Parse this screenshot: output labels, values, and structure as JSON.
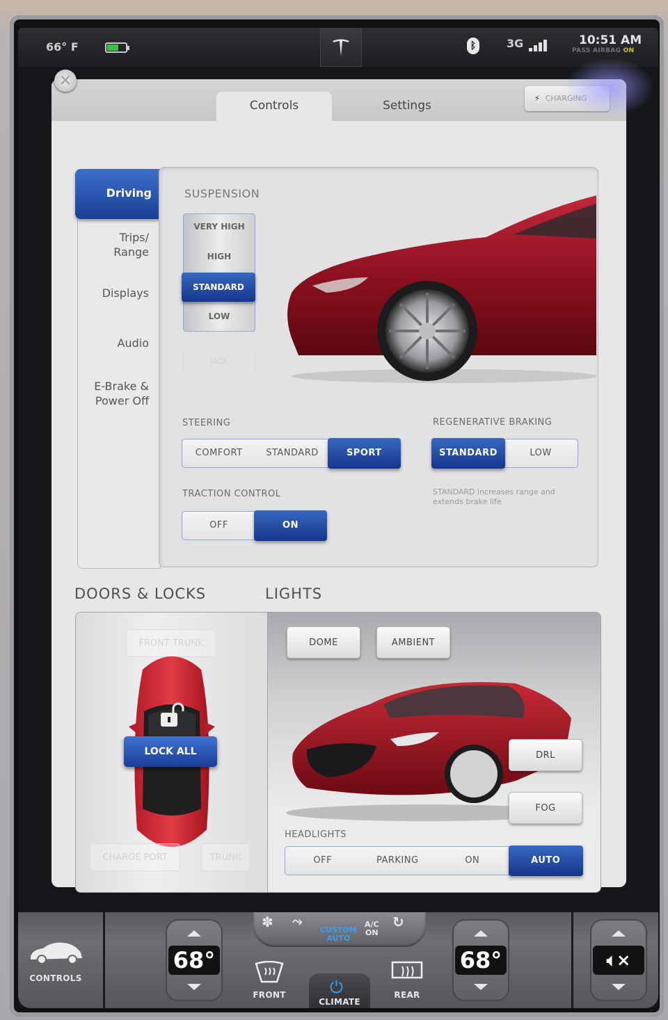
{
  "status_bar": {
    "outside_temp": "66° F",
    "battery_level_pct": 60,
    "battery_color": "#3fbd47",
    "logo_icon": "tesla-logo-icon",
    "bluetooth_icon": "bluetooth-icon",
    "network": "3G",
    "signal_bars": 4,
    "time": "10:51 AM",
    "airbag_label": "PASS AIRBAG",
    "airbag_state": "ON"
  },
  "panel": {
    "close_icon": "close-icon",
    "tabs": [
      {
        "label": "Controls",
        "active": true
      },
      {
        "label": "Settings",
        "active": false
      }
    ],
    "charging_button": "CHARGING"
  },
  "sidenav": {
    "items": [
      {
        "label": "Driving",
        "active": true
      },
      {
        "label": "Trips/ Range",
        "active": false
      },
      {
        "label": "Displays",
        "active": false
      },
      {
        "label": "Audio",
        "active": false
      },
      {
        "label": "E-Brake & Power Off",
        "active": false
      }
    ]
  },
  "driving": {
    "suspension": {
      "label": "SUSPENSION",
      "options": [
        "VERY HIGH",
        "HIGH",
        "STANDARD",
        "LOW"
      ],
      "selected": "STANDARD",
      "jack_label": "JACK"
    },
    "steering": {
      "label": "STEERING",
      "options": [
        "COMFORT",
        "STANDARD",
        "SPORT"
      ],
      "selected": "SPORT"
    },
    "regen_braking": {
      "label": "REGENERATIVE BRAKING",
      "options": [
        "STANDARD",
        "LOW"
      ],
      "selected": "STANDARD",
      "hint": "STANDARD increases range and extends brake life"
    },
    "traction_control": {
      "label": "TRACTION CONTROL",
      "options": [
        "OFF",
        "ON"
      ],
      "selected": "ON"
    }
  },
  "doors_locks": {
    "title": "DOORS & LOCKS",
    "front_trunk": "FRONT TRUNK",
    "lock_all": "LOCK ALL",
    "charge_port": "CHARGE PORT",
    "trunk": "TRUNK",
    "lock_state": "unlocked"
  },
  "lights": {
    "title": "LIGHTS",
    "dome": "DOME",
    "ambient": "AMBIENT",
    "drl": "DRL",
    "fog": "FOG",
    "headlights": {
      "label": "HEADLIGHTS",
      "options": [
        "OFF",
        "PARKING",
        "ON",
        "AUTO"
      ],
      "selected": "AUTO"
    }
  },
  "climate_bar": {
    "controls_label": "CONTROLS",
    "driver_temp": "68°",
    "passenger_temp": "68°",
    "fan_icon": "fan-icon",
    "airflow_icon": "airflow-icon",
    "mode_line1": "CUSTOM",
    "mode_line2": "AUTO",
    "ac_line1": "A/C",
    "ac_line2": "ON",
    "recirc_icon": "recirculate-icon",
    "front_defrost": "FRONT",
    "rear_defrost": "REAR",
    "climate_label": "CLIMATE",
    "volume_icon": "mute-icon",
    "accent_color": "#3c9df0"
  }
}
